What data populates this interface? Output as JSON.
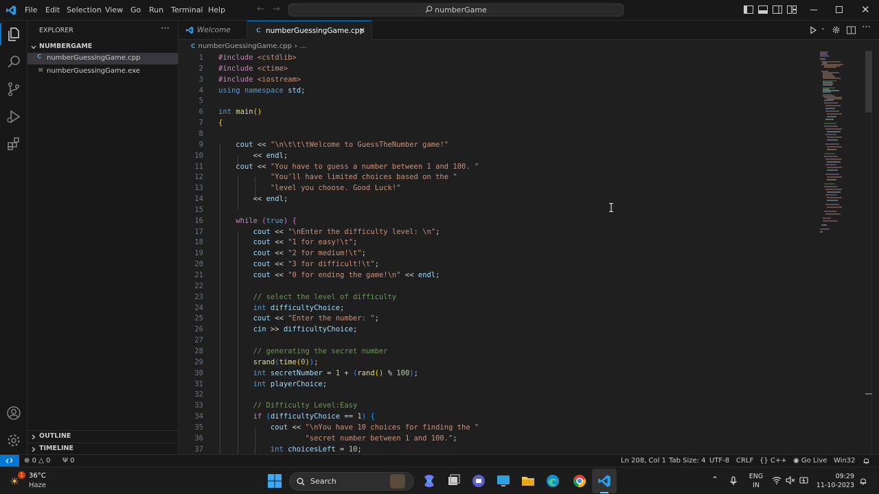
{
  "menu": {
    "items": [
      "File",
      "Edit",
      "Selection",
      "View",
      "Go",
      "Run",
      "Terminal",
      "Help"
    ]
  },
  "search": {
    "text": "numberGame"
  },
  "explorer": {
    "title": "EXPLORER",
    "folder": "NUMBERGAME",
    "files": [
      {
        "name": "numberGuessingGame.cpp",
        "icon": "cpp-file-icon",
        "selected": true
      },
      {
        "name": "numberGuessingGame.exe",
        "icon": "exe-file-icon",
        "selected": false
      }
    ],
    "outline": "OUTLINE",
    "timeline": "TIMELINE"
  },
  "tabs": [
    {
      "label": "Welcome",
      "active": false
    },
    {
      "label": "numberGuessingGame.cpp",
      "active": true
    }
  ],
  "breadcrumb": {
    "file": "numberGuessingGame.cpp",
    "rest": "..."
  },
  "code_lines": [
    {
      "n": "1",
      "t": "#include <cstdlib>"
    },
    {
      "n": "2",
      "t": "#include <ctime>"
    },
    {
      "n": "3",
      "t": "#include <iostream>"
    },
    {
      "n": "4",
      "t": "using namespace std;"
    },
    {
      "n": "5",
      "t": ""
    },
    {
      "n": "6",
      "t": "int main()"
    },
    {
      "n": "7",
      "t": "{"
    },
    {
      "n": "8",
      "t": ""
    },
    {
      "n": "9",
      "t": "    cout << \"\\n\\t\\t\\tWelcome to GuessTheNumber game!\""
    },
    {
      "n": "10",
      "t": "        << endl;"
    },
    {
      "n": "11",
      "t": "    cout << \"You have to guess a number between 1 and 100. \""
    },
    {
      "n": "12",
      "t": "            \"You'll have limited choices based on the \""
    },
    {
      "n": "13",
      "t": "            \"level you choose. Good Luck!\""
    },
    {
      "n": "14",
      "t": "        << endl;"
    },
    {
      "n": "15",
      "t": ""
    },
    {
      "n": "16",
      "t": "    while (true) {"
    },
    {
      "n": "17",
      "t": "        cout << \"\\nEnter the difficulty level: \\n\";"
    },
    {
      "n": "18",
      "t": "        cout << \"1 for easy!\\t\";"
    },
    {
      "n": "19",
      "t": "        cout << \"2 for medium!\\t\";"
    },
    {
      "n": "20",
      "t": "        cout << \"3 for difficult!\\t\";"
    },
    {
      "n": "21",
      "t": "        cout << \"0 for ending the game!\\n\" << endl;"
    },
    {
      "n": "22",
      "t": ""
    },
    {
      "n": "23",
      "t": "        // select the level of difficulty"
    },
    {
      "n": "24",
      "t": "        int difficultyChoice;"
    },
    {
      "n": "25",
      "t": "        cout << \"Enter the number: \";"
    },
    {
      "n": "26",
      "t": "        cin >> difficultyChoice;"
    },
    {
      "n": "27",
      "t": ""
    },
    {
      "n": "28",
      "t": "        // generating the secret number"
    },
    {
      "n": "29",
      "t": "        srand(time(0));"
    },
    {
      "n": "30",
      "t": "        int secretNumber = 1 + (rand() % 100);"
    },
    {
      "n": "31",
      "t": "        int playerChoice;"
    },
    {
      "n": "32",
      "t": ""
    },
    {
      "n": "33",
      "t": "        // Difficulty Level:Easy"
    },
    {
      "n": "34",
      "t": "        if (difficultyChoice == 1) {"
    },
    {
      "n": "35",
      "t": "            cout << \"\\nYou have 10 choices for finding the \""
    },
    {
      "n": "36",
      "t": "                    \"secret number between 1 and 100.\";"
    },
    {
      "n": "37",
      "t": "            int choicesLeft = 10;"
    }
  ],
  "status": {
    "errors": "0",
    "warnings": "0",
    "ports": "0",
    "position": "Ln 208, Col 1",
    "tabsize": "Tab Size: 4",
    "encoding": "UTF-8",
    "eol": "CRLF",
    "language": "{} C++",
    "golive": "Go Live",
    "platform": "Win32"
  },
  "taskbar": {
    "weather_temp": "36°C",
    "weather_desc": "Haze",
    "weather_badge": "1",
    "search": "Search",
    "lang1": "ENG",
    "lang2": "IN",
    "time": "09:29",
    "date": "11-10-2023"
  },
  "colors": {
    "accent": "#0078d4",
    "keyword": "#569cd6",
    "control": "#c586c0",
    "string": "#ce9178",
    "comment": "#6a9955",
    "function": "#dcdcaa",
    "variable": "#9cdcfe",
    "number": "#b5cea8",
    "text": "#d4d4d4"
  }
}
